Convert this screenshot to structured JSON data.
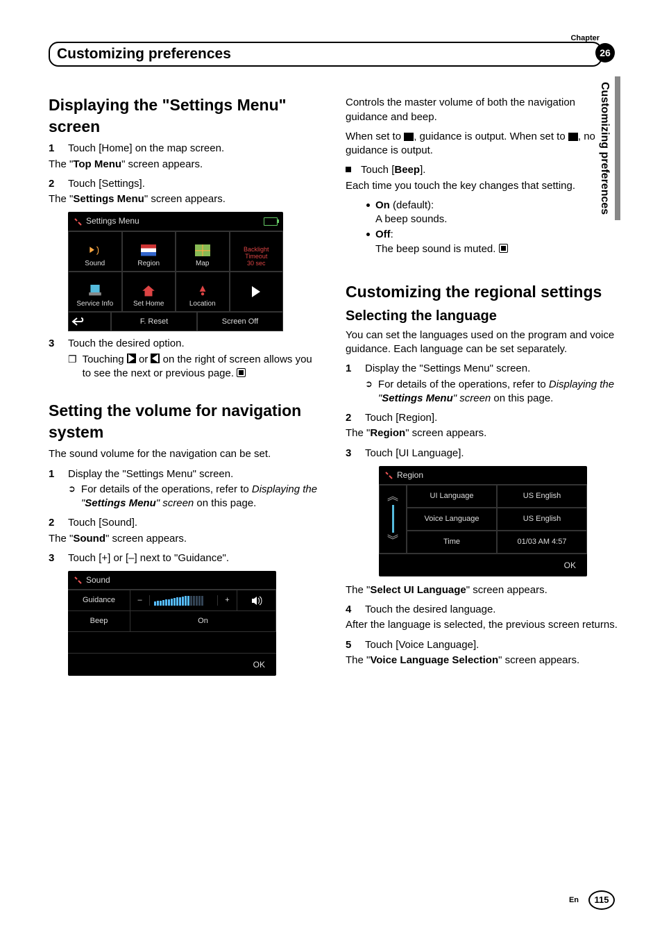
{
  "chapter": {
    "label": "Chapter",
    "number": "26"
  },
  "sectionTab": "Customizing preferences",
  "verticalTab": "Customizing preferences",
  "left": {
    "h1a": "Displaying the \"Settings Menu\" screen",
    "s1": {
      "n": "1",
      "t": "Touch [Home] on the map screen."
    },
    "p1a": "The \"",
    "p1b": "Top Menu",
    "p1c": "\" screen appears.",
    "s2": {
      "n": "2",
      "t": "Touch [Settings]."
    },
    "p2a": "The \"",
    "p2b": "Settings Menu",
    "p2c": "\" screen appears.",
    "ss1": {
      "title": "Settings Menu",
      "cells": [
        "Sound",
        "Region",
        "Map"
      ],
      "backlight": [
        "Backlight",
        "Timeout",
        "30 sec"
      ],
      "row2": [
        "Service Info",
        "Set Home",
        "Location"
      ],
      "bottom": [
        "",
        "F. Reset",
        "Screen Off"
      ]
    },
    "s3": {
      "n": "3",
      "t": "Touch the desired option."
    },
    "s3sub": " Touching ",
    "s3sub2": " or ",
    "s3sub3": " on the right of screen allows you to see the next or previous page.",
    "h1b": "Setting the volume for navigation system",
    "p3": "The sound volume for the navigation can be set.",
    "s4": {
      "n": "1",
      "t": "Display the \"Settings Menu\" screen."
    },
    "s4suba": "For details of the operations, refer to ",
    "s4subb": "Displaying the \"",
    "s4subc": "Settings Menu",
    "s4subd": "\" screen",
    "s4sube": " on this page.",
    "s5": {
      "n": "2",
      "t": "Touch [Sound]."
    },
    "p5a": "The \"",
    "p5b": "Sound",
    "p5c": "\" screen appears.",
    "s6": {
      "n": "3",
      "t": "Touch [+] or [–] next to \"Guidance\"."
    },
    "ss2": {
      "title": "Sound",
      "r1": "Guidance",
      "minus": "–",
      "plus": "+",
      "r2": "Beep",
      "r2v": "On",
      "ok": "OK"
    }
  },
  "right": {
    "p1": "Controls the master volume of both the navigation guidance and beep.",
    "p2a": "When set to ",
    "p2b": ", guidance is output. When set to ",
    "p2c": ", no guidance is output.",
    "bul1a": "Touch [",
    "bul1b": "Beep",
    "bul1c": "].",
    "p3": "Each time you touch the key changes that setting.",
    "on": "On",
    "onDef": " (default):",
    "onDesc": "A beep sounds.",
    "off": "Off",
    "offColon": ":",
    "offDesc": "The beep sound is muted.",
    "h1": "Customizing the regional settings",
    "h2": "Selecting the language",
    "p4": "You can set the languages used on the program and voice guidance. Each language can be set separately.",
    "s1": {
      "n": "1",
      "t": "Display the \"Settings Menu\" screen."
    },
    "s1suba": "For details of the operations, refer to ",
    "s1subb": "Displaying the \"",
    "s1subc": "Settings Menu",
    "s1subd": "\" screen",
    "s1sube": " on this page.",
    "s2": {
      "n": "2",
      "t": "Touch [Region]."
    },
    "p5a": "The \"",
    "p5b": "Region",
    "p5c": "\" screen appears.",
    "s3": {
      "n": "3",
      "t": "Touch [UI Language]."
    },
    "ss3": {
      "title": "Region",
      "r1a": "UI Language",
      "r1b": "US English",
      "r2a": "Voice Language",
      "r2b": "US English",
      "r3a": "Time",
      "r3b": "01/03 AM 4:57",
      "ok": "OK"
    },
    "p6a": "The \"",
    "p6b": "Select UI Language",
    "p6c": "\" screen appears.",
    "s4": {
      "n": "4",
      "t": "Touch the desired language."
    },
    "p7": "After the language is selected, the previous screen returns.",
    "s5": {
      "n": "5",
      "t": "Touch [Voice Language]."
    },
    "p8a": "The \"",
    "p8b": "Voice Language Selection",
    "p8c": "\" screen appears."
  },
  "footer": {
    "lang": "En",
    "page": "115"
  }
}
